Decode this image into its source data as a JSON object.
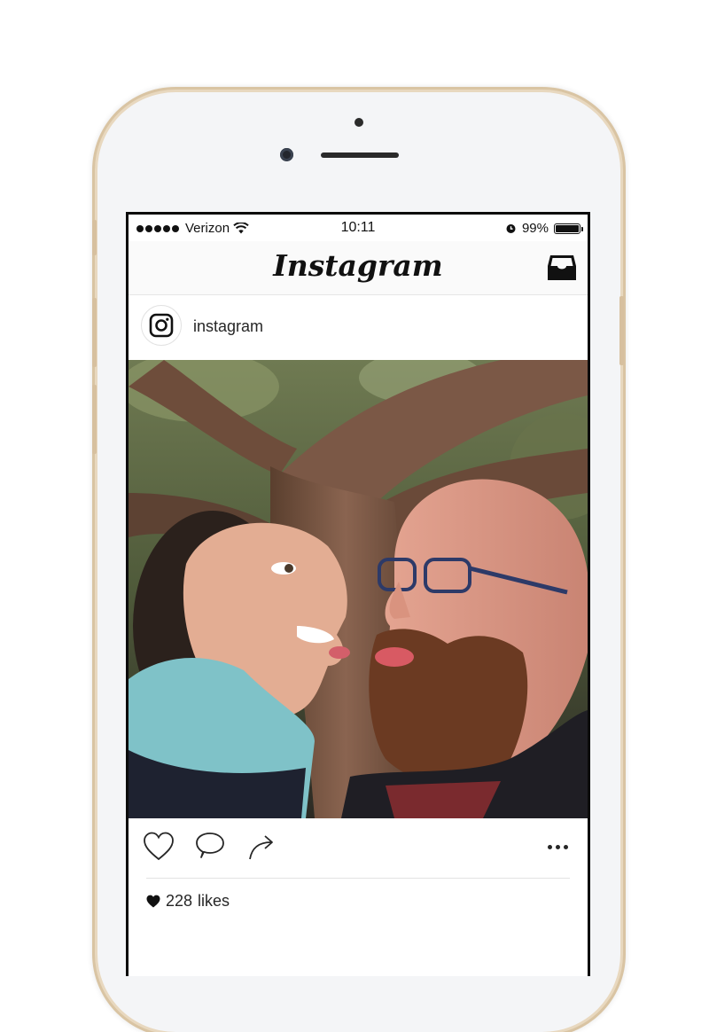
{
  "status": {
    "carrier": "Verizon",
    "time": "10:11",
    "battery": "99%",
    "battery_level": 0.99
  },
  "app": {
    "logo_text": "Instagram"
  },
  "post": {
    "username": "instagram",
    "likes_count": "228",
    "likes_label": "likes",
    "photo_description_icon": "photo"
  },
  "icons": {
    "inbox": "inbox-icon",
    "like": "heart-icon",
    "comment": "comment-icon",
    "share": "share-icon",
    "more": "more-icon",
    "avatar": "instagram-camera-icon"
  }
}
